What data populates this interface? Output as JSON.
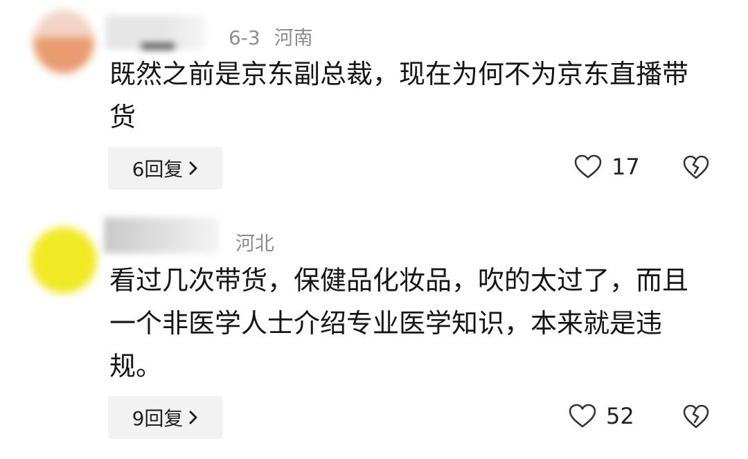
{
  "comments": [
    {
      "date": "6-3",
      "location": "河南",
      "text": "既然之前是京东副总裁，现在为何不为京东直播带货",
      "reply_label": "6回复",
      "like_count": "17"
    },
    {
      "date": "",
      "location": "河北",
      "text": "看过几次带货，保健品化妆品，吹的太过了，而且一个非医学人士介绍专业医学知识，本来就是违规。",
      "reply_label": "9回复",
      "like_count": "52"
    }
  ],
  "icons": {
    "like": "heart-outline-icon",
    "dislike": "broken-heart-icon",
    "reply_chevron": "chevron-right-icon"
  },
  "colors": {
    "meta_text": "#8d8d8d",
    "reply_button_bg": "#f2f2f2",
    "avatar_1": "#ea9b70",
    "avatar_2": "#f0ea24"
  }
}
